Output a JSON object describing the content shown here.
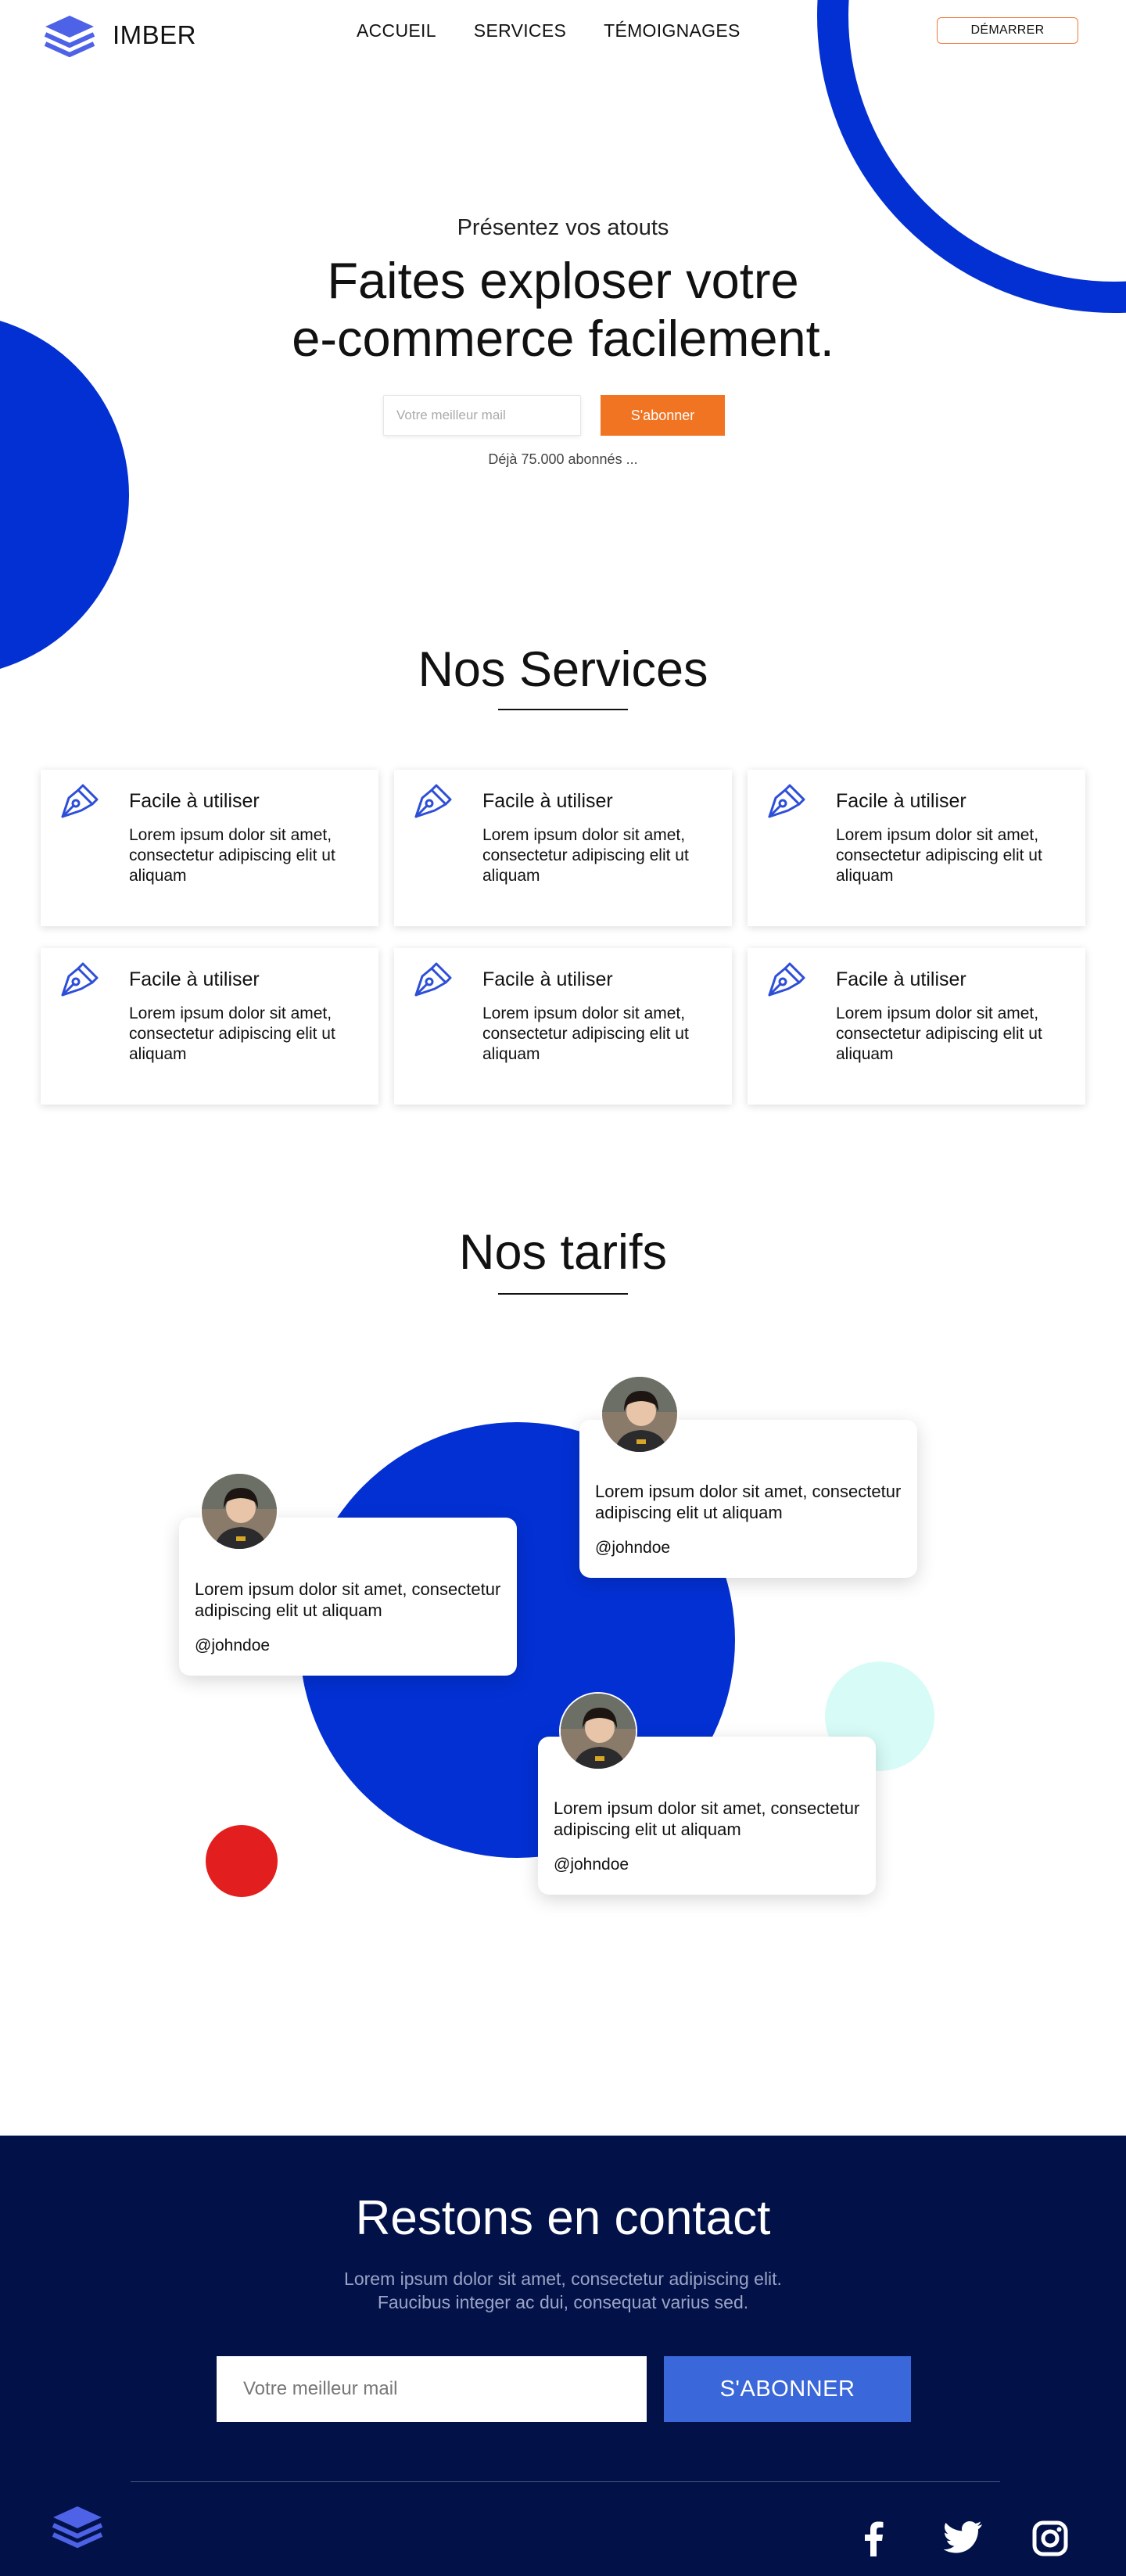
{
  "header": {
    "logo_text": "IMBER",
    "nav": [
      "ACCUEIL",
      "SERVICES",
      "TÉMOIGNAGES"
    ],
    "cta": "DÉMARRER"
  },
  "hero": {
    "kicker": "Présentez vos atouts",
    "title_line1": "Faites exploser votre",
    "title_line2": "e-commerce facilement.",
    "email_placeholder": "Votre meilleur mail",
    "subscribe": "S'abonner",
    "subscribers": "Déjà 75.000 abonnés ..."
  },
  "services": {
    "title": "Nos Services",
    "cards": [
      {
        "title": "Facile à utiliser",
        "text": "Lorem ipsum dolor sit amet, consectetur adipiscing elit ut aliquam"
      },
      {
        "title": "Facile à utiliser",
        "text": "Lorem ipsum dolor sit amet, consectetur adipiscing elit ut aliquam"
      },
      {
        "title": "Facile à utiliser",
        "text": "Lorem ipsum dolor sit amet, consectetur adipiscing elit ut aliquam"
      },
      {
        "title": "Facile à utiliser",
        "text": "Lorem ipsum dolor sit amet, consectetur adipiscing elit ut aliquam"
      },
      {
        "title": "Facile à utiliser",
        "text": "Lorem ipsum dolor sit amet, consectetur adipiscing elit ut aliquam"
      },
      {
        "title": "Facile à utiliser",
        "text": "Lorem ipsum dolor sit amet, consectetur adipiscing elit ut aliquam"
      }
    ]
  },
  "pricing": {
    "title": "Nos tarifs",
    "testimonials": [
      {
        "text": "Lorem ipsum dolor sit amet, consectetur adipiscing elit ut aliquam",
        "handle": "@johndoe"
      },
      {
        "text": "Lorem ipsum dolor sit amet, consectetur adipiscing elit ut aliquam",
        "handle": "@johndoe"
      },
      {
        "text": "Lorem ipsum dolor sit amet, consectetur adipiscing elit ut aliquam",
        "handle": "@johndoe"
      }
    ]
  },
  "footer": {
    "title": "Restons en contact",
    "desc_line1": "Lorem ipsum dolor sit amet, consectetur adipiscing elit.",
    "desc_line2": "Faucibus integer ac dui, consequat varius sed.",
    "email_placeholder": "Votre meilleur mail",
    "subscribe": "S'ABONNER",
    "social_icons": [
      "facebook-icon",
      "twitter-icon",
      "instagram-icon"
    ]
  },
  "colors": {
    "brand_blue": "#0330d3",
    "orange": "#f07422",
    "footer_bg": "#021248",
    "footer_button": "#3a67d9",
    "mint": "#d7fbf7",
    "red": "#e31e1e"
  }
}
